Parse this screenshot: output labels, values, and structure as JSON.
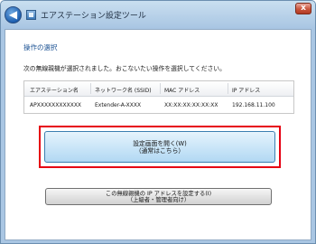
{
  "window": {
    "title": "エアステーション設定ツール",
    "close_glyph": "x",
    "back_glyph": "◀"
  },
  "page": {
    "section_title": "操作の選択",
    "instruction": "次の無線親機が選択されました。おこないたい操作を選択してください。"
  },
  "table": {
    "headers": [
      "エアステーション名",
      "ネットワーク名 (SSID)",
      "MAC アドレス",
      "IP アドレス"
    ],
    "row": [
      "APXXXXXXXXXXXX",
      "Extender-A-XXXX",
      "XX:XX:XX:XX:XX:XX",
      "192.168.11.100"
    ]
  },
  "buttons": {
    "settings_line1": "設定画面を開く(W)",
    "settings_line2": "（通常はこちら）",
    "ip_line1": "この無線親機の IP アドレスを設定する(I)",
    "ip_line2": "（上級者・管理者向け）"
  },
  "colors": {
    "highlight": "#e60012",
    "section_title": "#1d5394"
  }
}
